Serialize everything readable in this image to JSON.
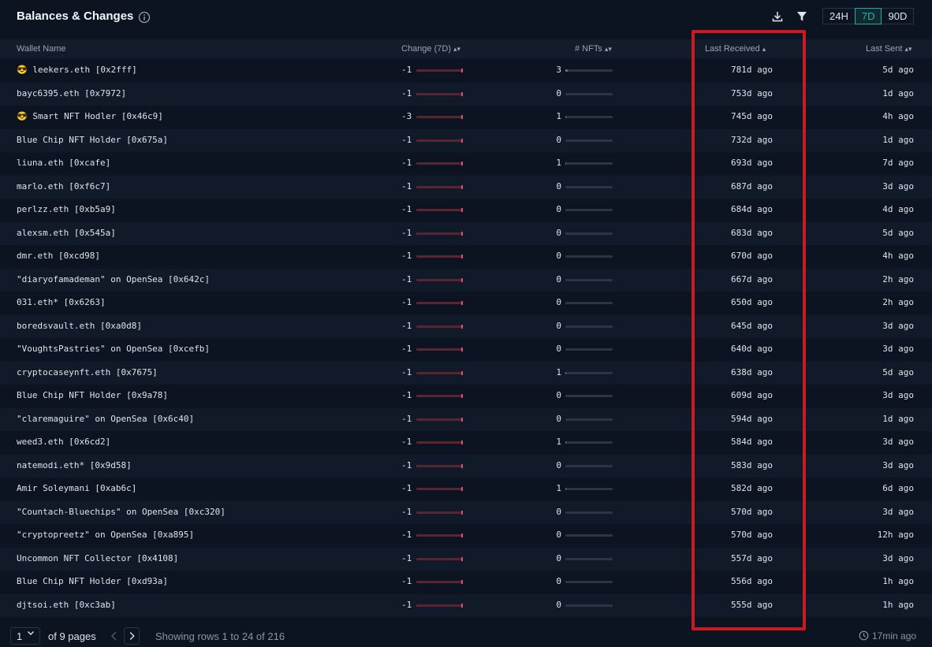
{
  "header": {
    "title": "Balances & Changes",
    "ranges": [
      "24H",
      "7D",
      "90D"
    ],
    "active_range": "7D"
  },
  "columns": {
    "wallet": "Wallet Name",
    "change": "Change (7D)",
    "nfts": "# NFTs",
    "last_received": "Last Received",
    "last_sent": "Last Sent"
  },
  "rows": [
    {
      "emoji": "😎",
      "name": "leekers.eth [0x2fff]",
      "change": "-1",
      "nfts": "3",
      "last_received": "781d ago",
      "last_sent": "5d ago"
    },
    {
      "emoji": "",
      "name": "bayc6395.eth [0x7972]",
      "change": "-1",
      "nfts": "0",
      "last_received": "753d ago",
      "last_sent": "1d ago"
    },
    {
      "emoji": "😎",
      "name": "Smart NFT Hodler [0x46c9]",
      "change": "-3",
      "nfts": "1",
      "last_received": "745d ago",
      "last_sent": "4h ago"
    },
    {
      "emoji": "",
      "name": "Blue Chip NFT Holder [0x675a]",
      "change": "-1",
      "nfts": "0",
      "last_received": "732d ago",
      "last_sent": "1d ago"
    },
    {
      "emoji": "",
      "name": "liuna.eth [0xcafe]",
      "change": "-1",
      "nfts": "1",
      "last_received": "693d ago",
      "last_sent": "7d ago"
    },
    {
      "emoji": "",
      "name": "marlo.eth [0xf6c7]",
      "change": "-1",
      "nfts": "0",
      "last_received": "687d ago",
      "last_sent": "3d ago"
    },
    {
      "emoji": "",
      "name": "perlzz.eth [0xb5a9]",
      "change": "-1",
      "nfts": "0",
      "last_received": "684d ago",
      "last_sent": "4d ago"
    },
    {
      "emoji": "",
      "name": "alexsm.eth [0x545a]",
      "change": "-1",
      "nfts": "0",
      "last_received": "683d ago",
      "last_sent": "5d ago"
    },
    {
      "emoji": "",
      "name": "dmr.eth [0xcd98]",
      "change": "-1",
      "nfts": "0",
      "last_received": "670d ago",
      "last_sent": "4h ago"
    },
    {
      "emoji": "",
      "name": "\"diaryofamademan\" on OpenSea [0x642c]",
      "change": "-1",
      "nfts": "0",
      "last_received": "667d ago",
      "last_sent": "2h ago"
    },
    {
      "emoji": "",
      "name": "031.eth* [0x6263]",
      "change": "-1",
      "nfts": "0",
      "last_received": "650d ago",
      "last_sent": "2h ago"
    },
    {
      "emoji": "",
      "name": "boredsvault.eth [0xa0d8]",
      "change": "-1",
      "nfts": "0",
      "last_received": "645d ago",
      "last_sent": "3d ago"
    },
    {
      "emoji": "",
      "name": "\"VoughtsPastries\" on OpenSea [0xcefb]",
      "change": "-1",
      "nfts": "0",
      "last_received": "640d ago",
      "last_sent": "3d ago"
    },
    {
      "emoji": "",
      "name": "cryptocaseynft.eth [0x7675]",
      "change": "-1",
      "nfts": "1",
      "last_received": "638d ago",
      "last_sent": "5d ago"
    },
    {
      "emoji": "",
      "name": "Blue Chip NFT Holder [0x9a78]",
      "change": "-1",
      "nfts": "0",
      "last_received": "609d ago",
      "last_sent": "3d ago"
    },
    {
      "emoji": "",
      "name": "\"claremaguire\" on OpenSea [0x6c40]",
      "change": "-1",
      "nfts": "0",
      "last_received": "594d ago",
      "last_sent": "1d ago"
    },
    {
      "emoji": "",
      "name": "weed3.eth [0x6cd2]",
      "change": "-1",
      "nfts": "1",
      "last_received": "584d ago",
      "last_sent": "3d ago"
    },
    {
      "emoji": "",
      "name": "natemodi.eth* [0x9d58]",
      "change": "-1",
      "nfts": "0",
      "last_received": "583d ago",
      "last_sent": "3d ago"
    },
    {
      "emoji": "",
      "name": "Amir Soleymani [0xab6c]",
      "change": "-1",
      "nfts": "1",
      "last_received": "582d ago",
      "last_sent": "6d ago"
    },
    {
      "emoji": "",
      "name": "\"Countach-Bluechips\" on OpenSea [0xc320]",
      "change": "-1",
      "nfts": "0",
      "last_received": "570d ago",
      "last_sent": "3d ago"
    },
    {
      "emoji": "",
      "name": "\"cryptopreetz\" on OpenSea [0xa895]",
      "change": "-1",
      "nfts": "0",
      "last_received": "570d ago",
      "last_sent": "12h ago"
    },
    {
      "emoji": "",
      "name": "Uncommon NFT Collector [0x4108]",
      "change": "-1",
      "nfts": "0",
      "last_received": "557d ago",
      "last_sent": "3d ago"
    },
    {
      "emoji": "",
      "name": "Blue Chip NFT Holder [0xd93a]",
      "change": "-1",
      "nfts": "0",
      "last_received": "556d ago",
      "last_sent": "1h ago"
    },
    {
      "emoji": "",
      "name": "djtsoi.eth [0xc3ab]",
      "change": "-1",
      "nfts": "0",
      "last_received": "555d ago",
      "last_sent": "1h ago"
    }
  ],
  "footer": {
    "page_value": "1",
    "of_pages": "of 9 pages",
    "showing": "Showing rows 1 to 24 of 216",
    "updated": "17min ago"
  },
  "colors": {
    "background": "#0c1321",
    "accent": "#24a7a0",
    "negative": "#e05060",
    "highlight_box": "#cc1a22"
  },
  "icons": {
    "info": "info-icon",
    "download": "download-icon",
    "filter": "filter-icon",
    "sort": "sort-icon",
    "clock": "clock-icon"
  }
}
